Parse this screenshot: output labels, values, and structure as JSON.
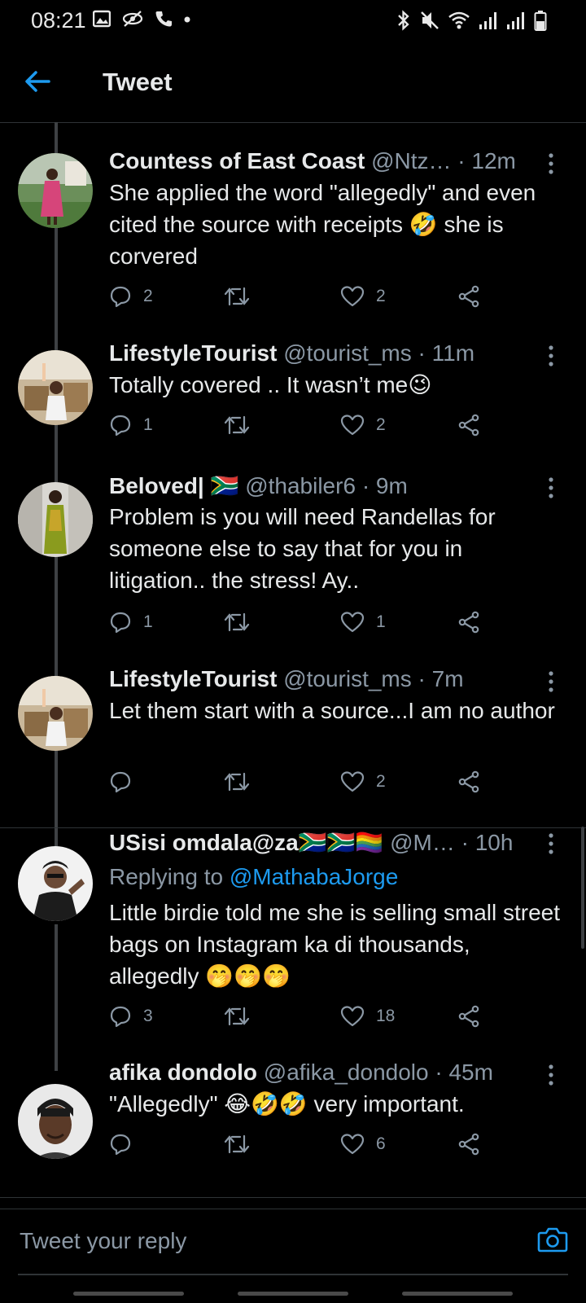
{
  "status_bar": {
    "time": "08:21",
    "left_icons": [
      "image-icon",
      "eye-off-icon",
      "phone-icon",
      "dot-icon"
    ],
    "right_icons": [
      "bluetooth-icon",
      "mute-icon",
      "wifi-icon",
      "signal-icon",
      "signal-icon",
      "battery-icon"
    ]
  },
  "header": {
    "title": "Tweet",
    "back_icon": "arrow-left-icon"
  },
  "colors": {
    "accent": "#1d9bf0",
    "background": "#000000",
    "secondary_text": "#8b98a5",
    "divider": "#2f3336"
  },
  "tweets": [
    {
      "name": "Countess of East Coast",
      "handle": "@Ntz…",
      "time": "· 12m",
      "text": "She applied the word \"allegedly\" and even cited the source with receipts 🤣 she is corvered",
      "replies": "2",
      "retweets": "",
      "likes": "2"
    },
    {
      "name": "LifestyleTourist",
      "handle": "@tourist_ms",
      "time": "· 11m",
      "text": "Totally covered .. It wasn’t me😉",
      "replies": "1",
      "retweets": "",
      "likes": "2"
    },
    {
      "name": "Beloved| 🇿🇦",
      "handle": "@thabiler6",
      "time": "· 9m",
      "text": "Problem is you will need Randellas for someone else to say that for you in litigation.. the stress! Ay..",
      "replies": "1",
      "retweets": "",
      "likes": "1"
    },
    {
      "name": "LifestyleTourist",
      "handle": "@tourist_ms",
      "time": "· 7m",
      "text": "Let them start with a source...I am no author",
      "replies": "",
      "retweets": "",
      "likes": "2"
    },
    {
      "name": "USisi omdala@za🇿🇦🇿🇦🏳️‍🌈",
      "handle": "@M…",
      "time": "· 10h",
      "replying_prefix": "Replying to",
      "replying_to": "@MathabaJorge",
      "text": "Little birdie told me she is selling small street bags on Instagram ka di thousands, allegedly 🤭🤭🤭",
      "replies": "3",
      "retweets": "",
      "likes": "18"
    },
    {
      "name": "afika dondolo",
      "handle": "@afika_dondolo",
      "time": "· 45m",
      "text": "\"Allegedly\" 😂🤣🤣 very important.",
      "replies": "",
      "retweets": "",
      "likes": "6"
    }
  ],
  "reply_bar": {
    "placeholder": "Tweet your reply",
    "camera_icon": "camera-icon"
  }
}
